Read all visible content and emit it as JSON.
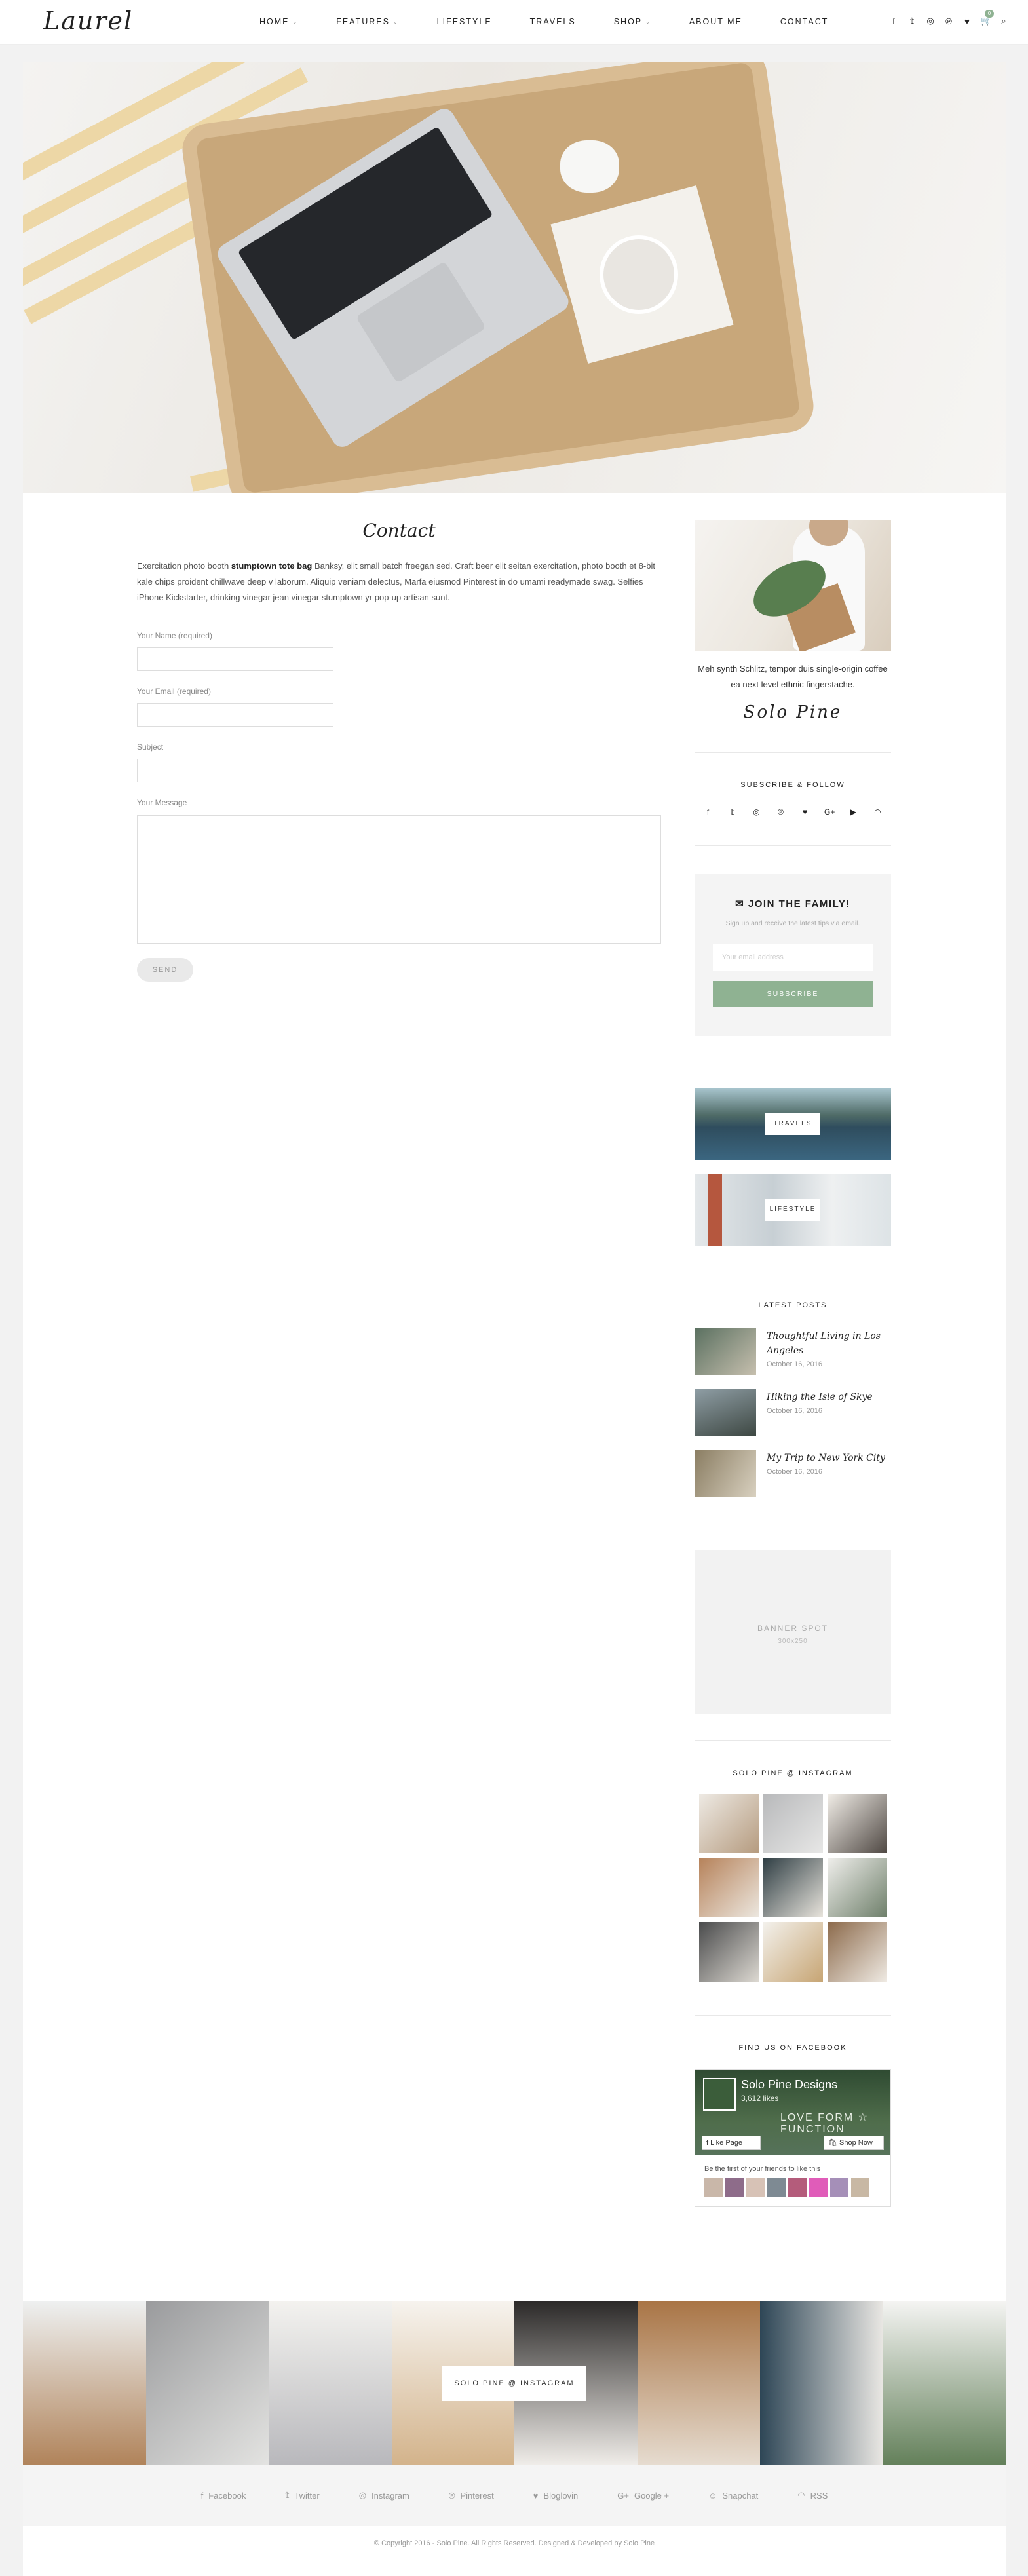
{
  "header": {
    "logo": "Laurel",
    "nav": [
      {
        "label": "HOME",
        "caret": "⌄"
      },
      {
        "label": "FEATURES",
        "caret": "⌄"
      },
      {
        "label": "LIFESTYLE",
        "caret": ""
      },
      {
        "label": "TRAVELS",
        "caret": ""
      },
      {
        "label": "SHOP",
        "caret": "⌄"
      },
      {
        "label": "ABOUT ME",
        "caret": ""
      },
      {
        "label": "CONTACT",
        "caret": ""
      }
    ],
    "social_icons": [
      "facebook-icon",
      "twitter-icon",
      "instagram-icon",
      "pinterest-icon",
      "heart-icon"
    ],
    "social_glyphs": [
      "f",
      "𝕥",
      "◎",
      "℗",
      "♥"
    ],
    "cart_count": "0",
    "cart_glyph": "🛒",
    "search_glyph": "⌕"
  },
  "contact": {
    "title": "Contact",
    "intro_before": "Exercitation photo booth ",
    "intro_bold": "stumptown tote bag",
    "intro_after": " Banksy, elit small batch freegan sed. Craft beer elit seitan exercitation, photo booth et 8-bit kale chips proident chillwave deep v laborum. Aliquip veniam delectus, Marfa eiusmod Pinterest in do umami readymade swag. Selfies iPhone Kickstarter, drinking vinegar jean vinegar stumptown yr pop-up artisan sunt.",
    "fields": {
      "name_label": "Your Name (required)",
      "email_label": "Your Email (required)",
      "subject_label": "Subject",
      "message_label": "Your Message"
    },
    "send_label": "SEND"
  },
  "sidebar": {
    "about_text": "Meh synth Schlitz, tempor duis single-origin coffee ea next level ethnic fingerstache.",
    "signature": "Solo Pine",
    "subscribe_title": "SUBSCRIBE & FOLLOW",
    "follow_glyphs": [
      "f",
      "𝕥",
      "◎",
      "℗",
      "♥",
      "G+",
      "▶",
      "◠"
    ],
    "newsletter": {
      "title": "JOIN THE FAMILY!",
      "subtitle": "Sign up and receive the latest tips via email.",
      "placeholder": "Your email address",
      "button": "SUBSCRIBE"
    },
    "promos": [
      {
        "label": "TRAVELS"
      },
      {
        "label": "LIFESTYLE"
      }
    ],
    "latest_title": "LATEST POSTS",
    "posts": [
      {
        "title": "Thoughtful Living in Los Angeles",
        "date": "October 16, 2016"
      },
      {
        "title": "Hiking the Isle of Skye",
        "date": "October 16, 2016"
      },
      {
        "title": "My Trip to New York City",
        "date": "October 16, 2016"
      }
    ],
    "banner": {
      "title": "BANNER SPOT",
      "size": "300x250"
    },
    "instagram_title": "SOLO PINE @ INSTAGRAM",
    "facebook_title": "FIND US ON FACEBOOK",
    "facebook": {
      "page_name": "Solo Pine Designs",
      "likes": "3,612 likes",
      "tagline": "LOVE FORM ☆ FUNCTION",
      "like_label": "Like Page",
      "shop_label": "Shop Now",
      "friends": "Be the first of your friends to like this"
    }
  },
  "footer": {
    "instagram_label": "SOLO PINE @ INSTAGRAM",
    "social": [
      {
        "glyph": "f",
        "label": "Facebook"
      },
      {
        "glyph": "𝕥",
        "label": "Twitter"
      },
      {
        "glyph": "◎",
        "label": "Instagram"
      },
      {
        "glyph": "℗",
        "label": "Pinterest"
      },
      {
        "glyph": "♥",
        "label": "Bloglovin"
      },
      {
        "glyph": "G+",
        "label": "Google +"
      },
      {
        "glyph": "☺",
        "label": "Snapchat"
      },
      {
        "glyph": "◠",
        "label": "RSS"
      }
    ],
    "copyright": "© Copyright 2016 - Solo Pine. All Rights Reserved. Designed & Developed by Solo Pine"
  }
}
